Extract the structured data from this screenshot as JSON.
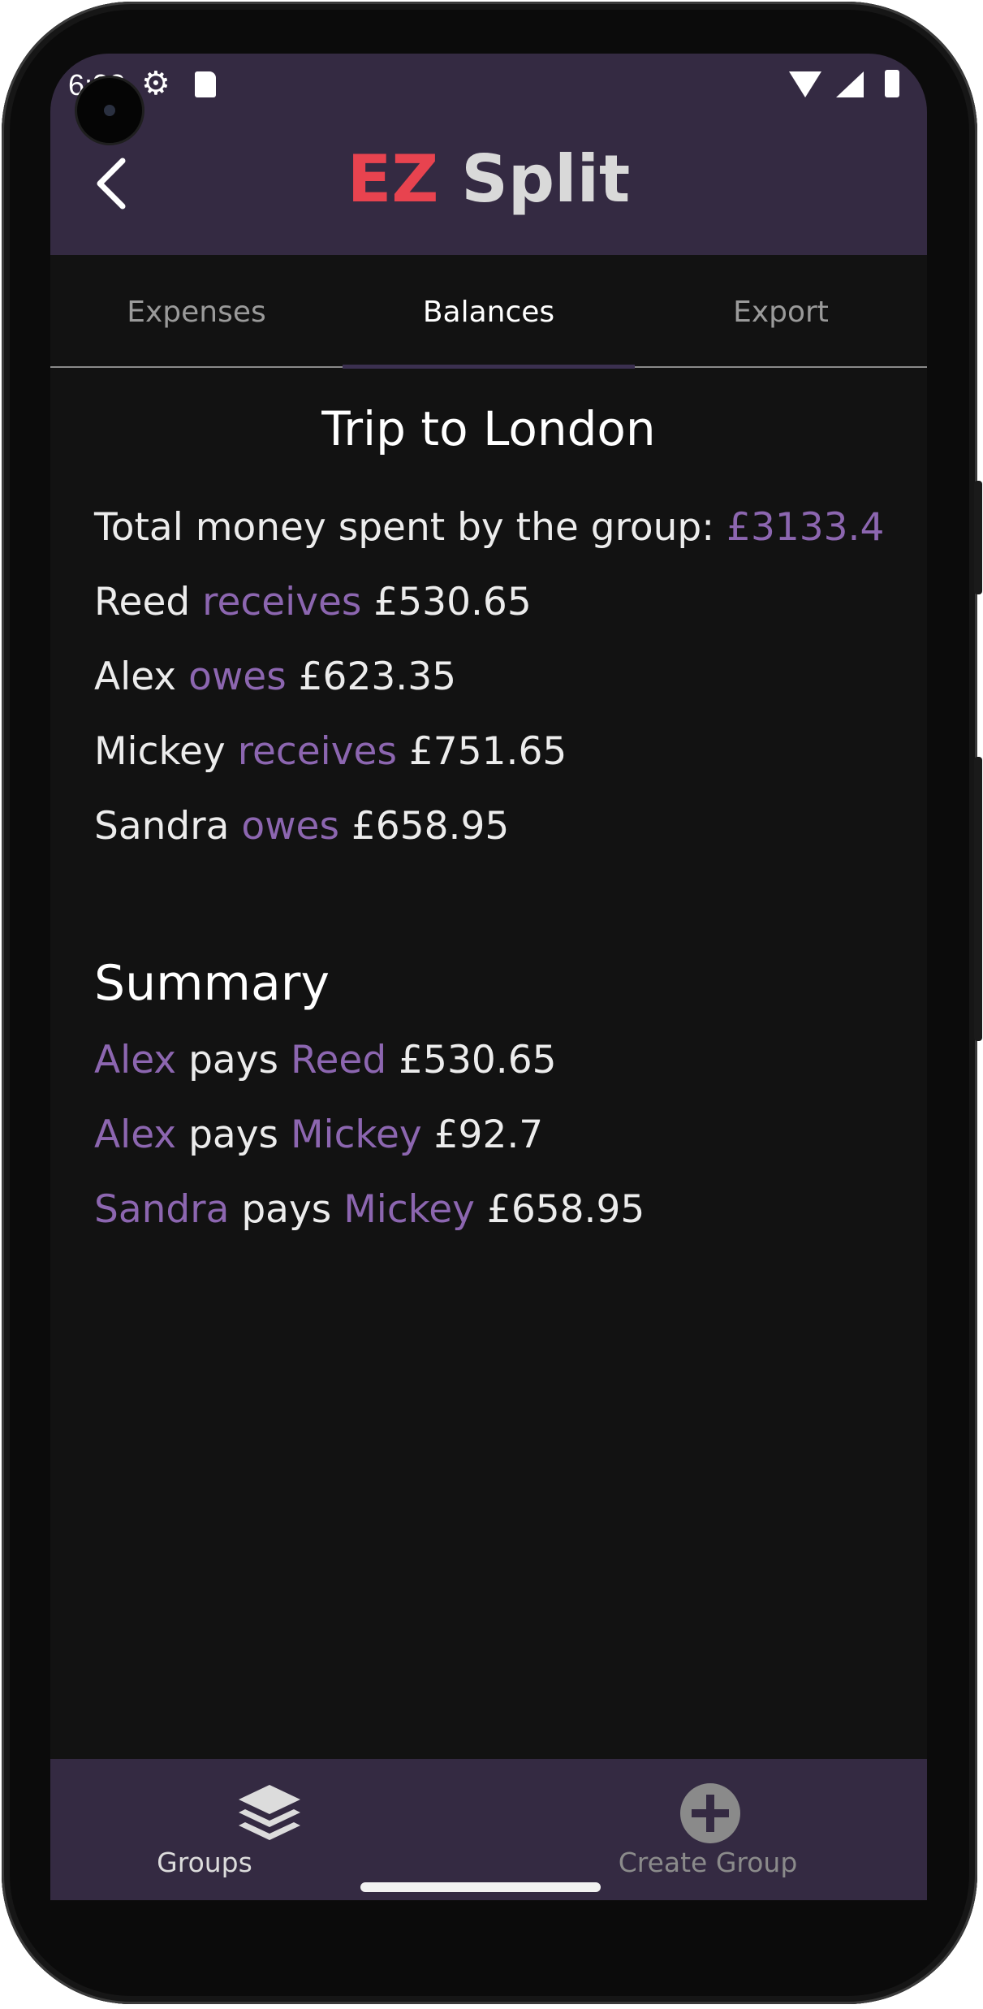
{
  "status_bar": {
    "time": "6:22",
    "gear_icon": "gear-icon",
    "sd_icon": "sd-card-icon",
    "wifi_icon": "wifi-icon",
    "signal_icon": "signal-icon",
    "battery_icon": "battery-icon"
  },
  "header": {
    "title_prefix": "EZ",
    "title_suffix": "Split",
    "back_icon": "chevron-left-icon",
    "title_prefix_color": "#e8434f",
    "background": "#342a42"
  },
  "tabs": [
    {
      "label": "Expenses",
      "active": false
    },
    {
      "label": "Balances",
      "active": true
    },
    {
      "label": "Export",
      "active": false
    }
  ],
  "balances": {
    "group_name": "Trip to London",
    "total_label": "Total money spent by the group: ",
    "total_value": "£3133.4",
    "entries": [
      {
        "name": "Reed",
        "verb": "receives",
        "amount": "£530.65"
      },
      {
        "name": "Alex",
        "verb": "owes",
        "amount": "£623.35"
      },
      {
        "name": "Mickey",
        "verb": "receives",
        "amount": "£751.65"
      },
      {
        "name": "Sandra",
        "verb": "owes",
        "amount": "£658.95"
      }
    ]
  },
  "summary": {
    "title": "Summary",
    "pays_word": "pays",
    "transfers": [
      {
        "from": "Alex",
        "to": "Reed",
        "amount": "£530.65"
      },
      {
        "from": "Alex",
        "to": "Mickey",
        "amount": "£92.7"
      },
      {
        "from": "Sandra",
        "to": "Mickey",
        "amount": "£658.95"
      }
    ]
  },
  "bottom_nav": [
    {
      "label": "Groups",
      "icon": "layers-icon",
      "active": true
    },
    {
      "label": "Create Group",
      "icon": "add-circle-icon",
      "active": false
    }
  ],
  "colors": {
    "accent": "#8c66b0",
    "background": "#121212"
  }
}
